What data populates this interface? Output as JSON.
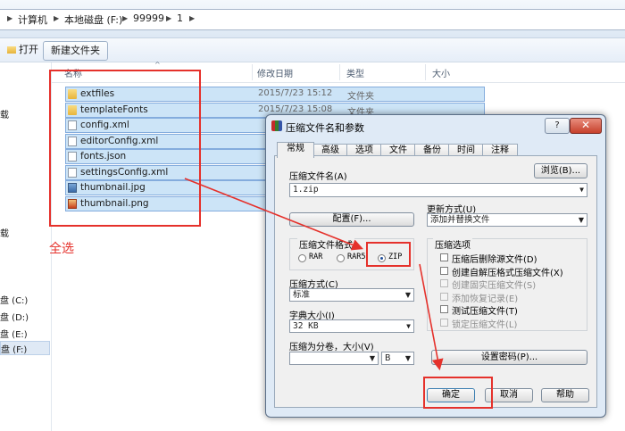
{
  "breadcrumb": {
    "items": [
      "计算机",
      "本地磁盘 (F:)",
      "99999",
      "1"
    ]
  },
  "toolbar": {
    "open_label": "打开",
    "new_folder_label": "新建文件夹"
  },
  "nav": {
    "items": [
      "载",
      "载",
      "盘 (C:)",
      "盘 (D:)",
      "盘 (E:)",
      "盘 (F:)"
    ]
  },
  "columns": {
    "name": "名称",
    "date": "修改日期",
    "type": "类型",
    "size": "大小"
  },
  "files": [
    {
      "name": "extfiles",
      "date": "2015/7/23 15:12",
      "type": "文件夹",
      "icon": "folder-icon"
    },
    {
      "name": "templateFonts",
      "date": "2015/7/23 15:08",
      "type": "文件夹",
      "icon": "folder-icon"
    },
    {
      "name": "config.xml",
      "date": "",
      "type": "",
      "icon": "file-icon"
    },
    {
      "name": "editorConfig.xml",
      "date": "",
      "type": "",
      "icon": "file-icon"
    },
    {
      "name": "fonts.json",
      "date": "",
      "type": "",
      "icon": "file-icon"
    },
    {
      "name": "settingsConfig.xml",
      "date": "",
      "type": "",
      "icon": "file-icon"
    },
    {
      "name": "thumbnail.jpg",
      "date": "",
      "type": "",
      "icon": "image-icon"
    },
    {
      "name": "thumbnail.png",
      "date": "",
      "type": "",
      "icon": "image-icon"
    }
  ],
  "annotation": {
    "select_all": "全选",
    "color": "#e5312b"
  },
  "dialog": {
    "title": "压缩文件名和参数",
    "help": "?",
    "close": "✕",
    "tabs": [
      "常规",
      "高级",
      "选项",
      "文件",
      "备份",
      "时间",
      "注释"
    ],
    "archive_name_label": "压缩文件名(A)",
    "archive_name_value": "1.zip",
    "browse_label": "浏览(B)...",
    "profile_button": "配置(F)...",
    "update_mode_label": "更新方式(U)",
    "update_mode_value": "添加并替换文件",
    "format_group_label": "压缩文件格式",
    "formats": [
      "RAR",
      "RAR5",
      "ZIP"
    ],
    "selected_format": "ZIP",
    "method_label": "压缩方式(C)",
    "method_value": "标准",
    "dict_label": "字典大小(I)",
    "dict_value": "32 KB",
    "split_label": "压缩为分卷，大小(V)",
    "split_value": "",
    "split_unit": "B",
    "options_group_label": "压缩选项",
    "options": [
      {
        "label": "压缩后删除源文件(D)",
        "checked": false,
        "disabled": false
      },
      {
        "label": "创建自解压格式压缩文件(X)",
        "checked": false,
        "disabled": false
      },
      {
        "label": "创建固实压缩文件(S)",
        "checked": false,
        "disabled": true
      },
      {
        "label": "添加恢复记录(E)",
        "checked": false,
        "disabled": true
      },
      {
        "label": "测试压缩文件(T)",
        "checked": false,
        "disabled": false
      },
      {
        "label": "锁定压缩文件(L)",
        "checked": false,
        "disabled": true
      }
    ],
    "password_button": "设置密码(P)...",
    "ok": "确定",
    "cancel": "取消",
    "help_button": "帮助"
  }
}
